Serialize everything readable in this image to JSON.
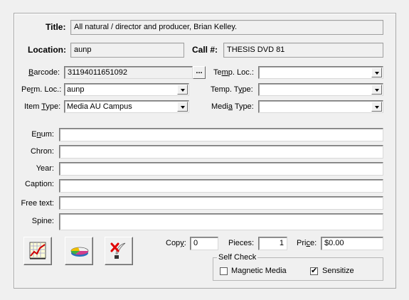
{
  "header": {
    "title_label": "Title:",
    "title_value": "All natural / director and producer, Brian Kelley.",
    "location_label": "Location:",
    "location_value": "aunp",
    "call_label": "Call #:",
    "call_value": "THESIS DVD 81"
  },
  "item": {
    "barcode_label_pre": "B",
    "barcode_label_post": "arcode:",
    "barcode_value": "31194011651092",
    "barcode_browse_label": "...",
    "perm_loc_label_pre": "Pe",
    "perm_loc_label_u": "r",
    "perm_loc_label_post": "m. Loc.:",
    "perm_loc_value": "aunp",
    "item_type_label_pre": "Item ",
    "item_type_label_u": "T",
    "item_type_label_post": "ype:",
    "item_type_value": "Media AU Campus",
    "temp_loc_label_pre": "Te",
    "temp_loc_label_u": "m",
    "temp_loc_label_post": "p. Loc.:",
    "temp_loc_value": "",
    "temp_type_label_pre": "Temp. T",
    "temp_type_label_u": "y",
    "temp_type_label_post": "pe:",
    "temp_type_value": "",
    "media_type_label_pre": "Medi",
    "media_type_label_u": "a",
    "media_type_label_post": " Type:",
    "media_type_value": ""
  },
  "details": {
    "enum_label_pre": "E",
    "enum_label_u": "n",
    "enum_label_post": "um:",
    "enum_value": "",
    "chron_label": "Chron:",
    "chron_value": "",
    "year_label": "Year:",
    "year_value": "",
    "caption_label": "Caption:",
    "caption_value": "",
    "freetext_label": "Free text:",
    "freetext_value": "",
    "spine_label": "Spine:",
    "spine_value": ""
  },
  "bottom": {
    "copy_label_pre": "Cop",
    "copy_label_u": "y",
    "copy_label_post": ":",
    "copy_value": "0",
    "pieces_label": "Pieces:",
    "pieces_value": "1",
    "price_label_pre": "Pri",
    "price_label_u": "c",
    "price_label_post": "e:",
    "price_value": "$0.00",
    "selfcheck_title": "Self Check",
    "magnetic_label": "Magnetic Media",
    "magnetic_checked": false,
    "sensitize_label": "Sensitize",
    "sensitize_checked": true,
    "check_glyph": "✔"
  },
  "icons": [
    "chart-icon",
    "pie-chart-icon",
    "quill-delete-icon"
  ]
}
